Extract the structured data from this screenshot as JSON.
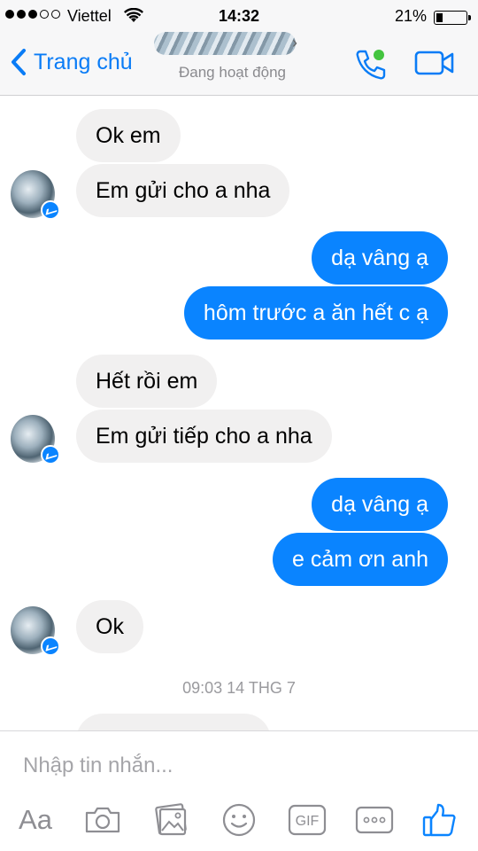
{
  "status_bar": {
    "carrier": "Viettel",
    "time": "14:32",
    "battery_percent": "21%",
    "battery_level": 0.21,
    "signal_bars": 3,
    "signal_total": 5
  },
  "header": {
    "back_label": "Trang chủ",
    "contact_status": "Đang hoạt động",
    "icons": {
      "back": "chevron-left-icon",
      "call": "phone-icon",
      "video": "video-camera-icon"
    },
    "accent_color": "#0a7cf6",
    "online_color": "#44c43f"
  },
  "messages": [
    {
      "direction": "in",
      "text": "Ok em"
    },
    {
      "direction": "in",
      "text": "Em gửi cho a nha"
    },
    {
      "direction": "out",
      "text": "dạ vâng ạ"
    },
    {
      "direction": "out",
      "text": "hôm trước a ăn hết c ạ"
    },
    {
      "direction": "in",
      "text": "Hết rồi em"
    },
    {
      "direction": "in",
      "text": "Em gửi tiếp cho a nha"
    },
    {
      "direction": "out",
      "text": "dạ vâng ạ"
    },
    {
      "direction": "out",
      "text": "e cảm ơn anh"
    },
    {
      "direction": "in",
      "text": "Ok"
    }
  ],
  "timestamp": "09:03 14 THG 7",
  "composer": {
    "placeholder": "Nhập tin nhắn...",
    "aa_label": "Aa",
    "gif_label": "GIF",
    "tools": [
      "text-format-icon",
      "camera-icon",
      "photo-icon",
      "sticker-icon",
      "gif-icon",
      "more-icon",
      "like-icon"
    ]
  },
  "colors": {
    "outgoing_bubble": "#0a84ff",
    "incoming_bubble": "#f1f0f0",
    "like": "#0a84ff"
  }
}
